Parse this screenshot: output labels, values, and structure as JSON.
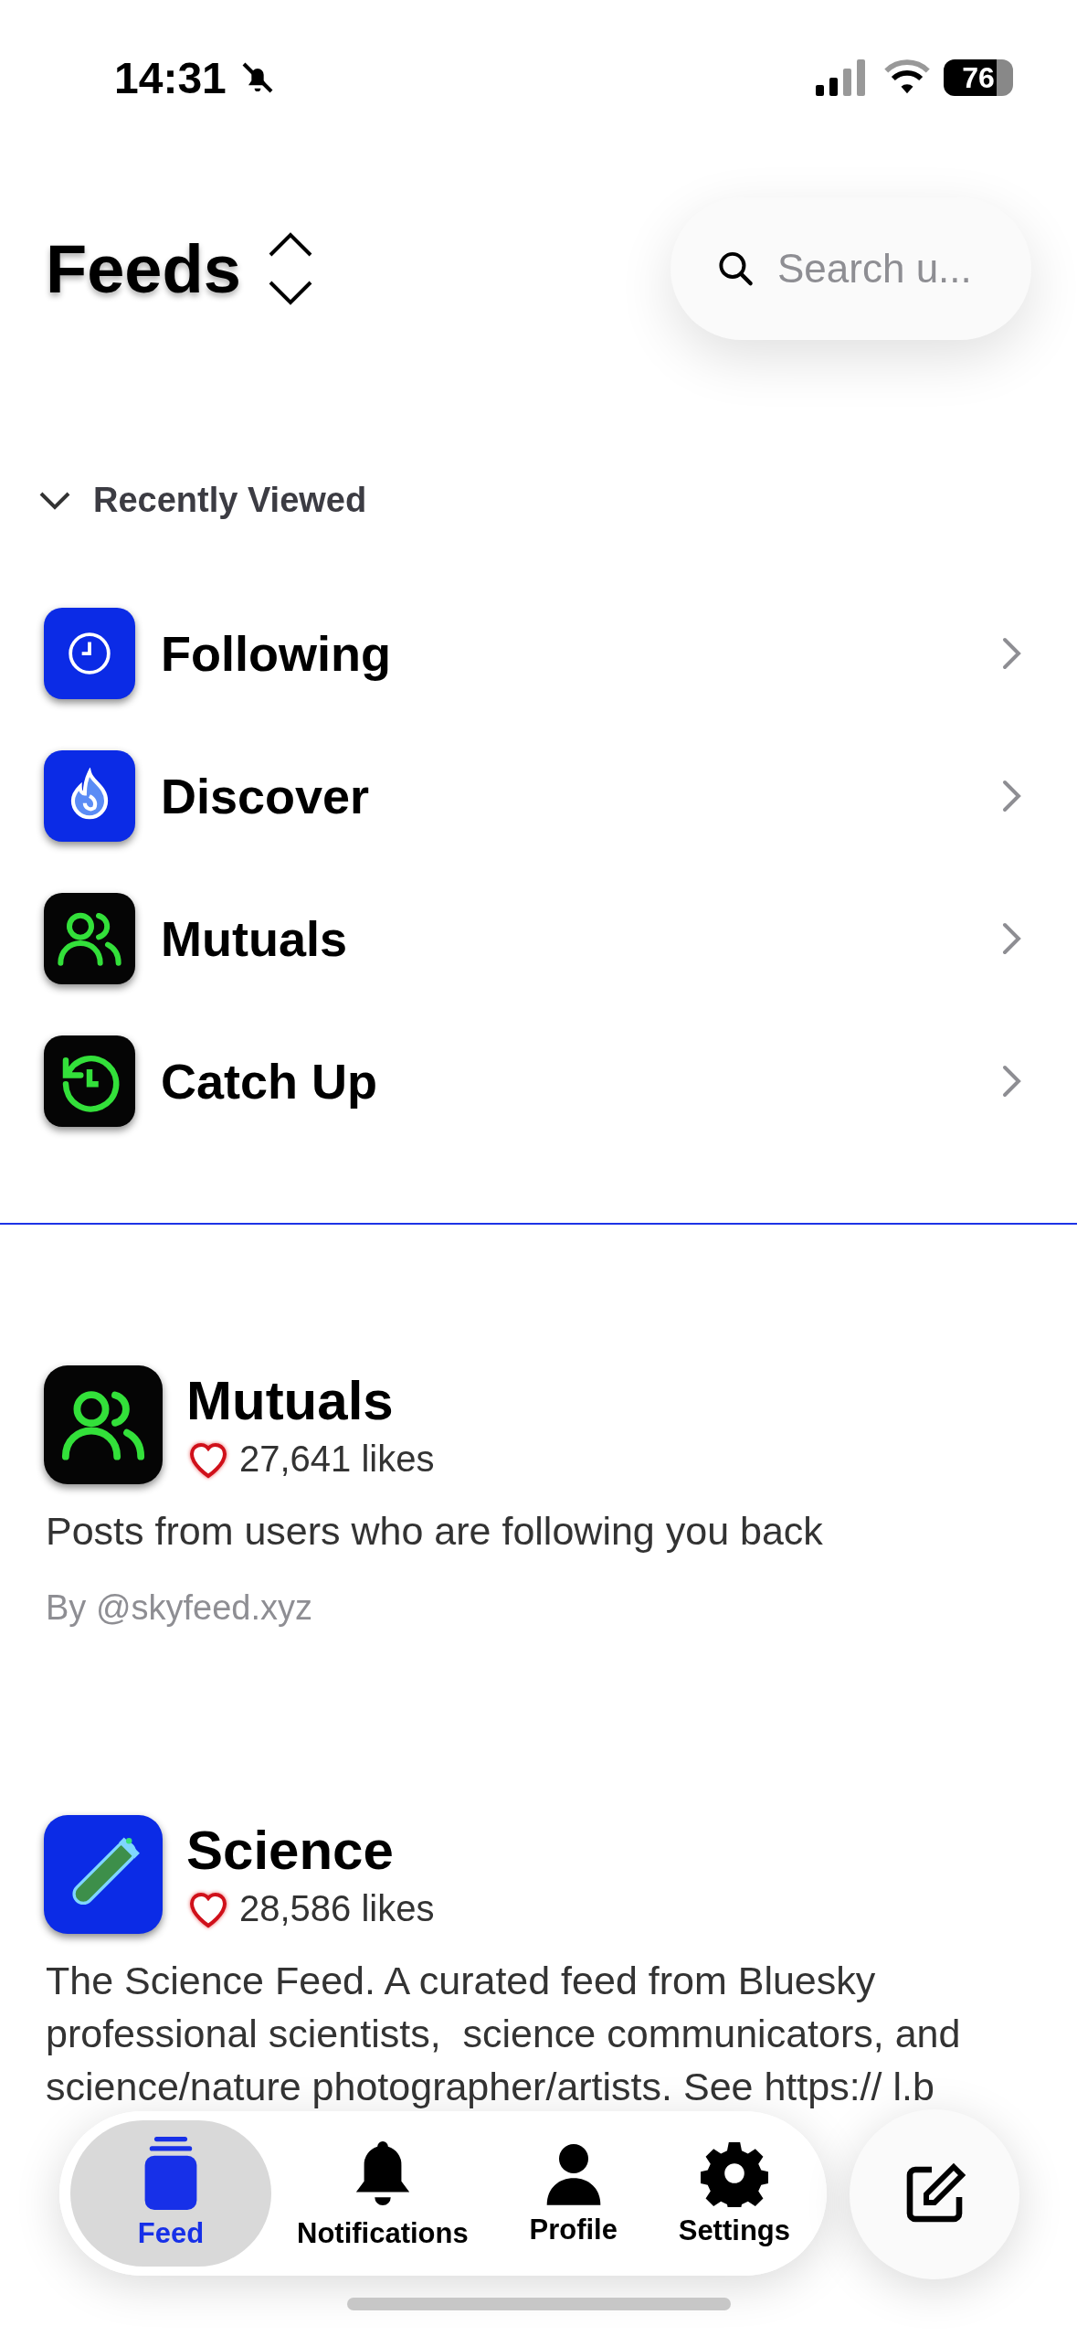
{
  "status_bar": {
    "time": "14:31",
    "battery": "76"
  },
  "header": {
    "title": "Feeds",
    "search": {
      "placeholder": "Search u..."
    }
  },
  "recently_viewed": {
    "label": "Recently Viewed",
    "expanded": true,
    "items": [
      {
        "name": "Following"
      },
      {
        "name": "Discover"
      },
      {
        "name": "Mutuals"
      },
      {
        "name": "Catch Up"
      }
    ]
  },
  "feeds": [
    {
      "title": "Mutuals",
      "likes": "27,641 likes",
      "description": "Posts from users who are following you back",
      "author": "By @skyfeed.xyz"
    },
    {
      "title": "Science",
      "likes": "28,586 likes",
      "description": "The Science Feed. A curated feed from Bluesky professional scientists,  science communicators, and science/nature photographer/artists. See https:// l.b"
    }
  ],
  "tab_bar": {
    "tabs": [
      {
        "label": "Feed",
        "selected": true
      },
      {
        "label": "Notifications",
        "selected": false
      },
      {
        "label": "Profile",
        "selected": false
      },
      {
        "label": "Settings",
        "selected": false
      }
    ]
  }
}
